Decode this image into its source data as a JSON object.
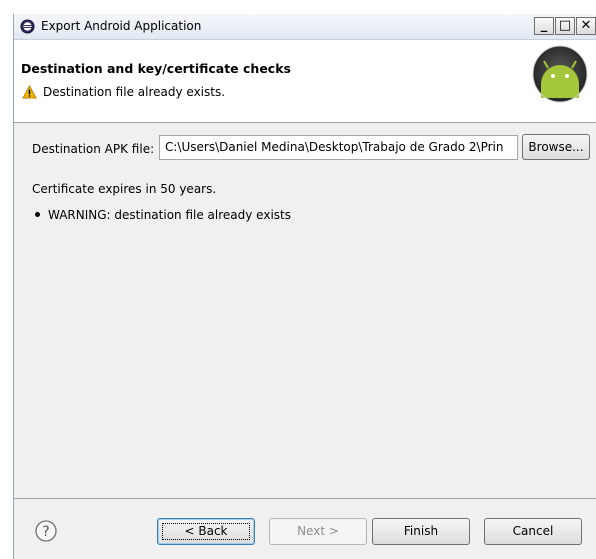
{
  "window": {
    "title": "Export Android Application",
    "minimize_glyph": "_",
    "maximize_glyph": "□",
    "close_glyph": "✕"
  },
  "header": {
    "title": "Destination and key/certificate checks",
    "message": "Destination file already exists.",
    "message_icon": "warning-icon",
    "logo": "android-logo"
  },
  "destination": {
    "label": "Destination APK file:",
    "value": "C:\\Users\\Daniel Medina\\Desktop\\Trabajo de Grado 2\\Prin",
    "browse_label": "Browse..."
  },
  "status": {
    "certificate": "Certificate expires in 50 years.",
    "warning": "WARNING: destination file already exists"
  },
  "footer": {
    "help_icon": "help-icon",
    "back_label": "< Back",
    "next_label": "Next >",
    "finish_label": "Finish",
    "cancel_label": "Cancel",
    "next_enabled": false
  },
  "colors": {
    "dialog_bg": "#f0f0f0",
    "banner_bg": "#ffffff",
    "warning": "#f2b705",
    "android_green": "#a4c639"
  }
}
